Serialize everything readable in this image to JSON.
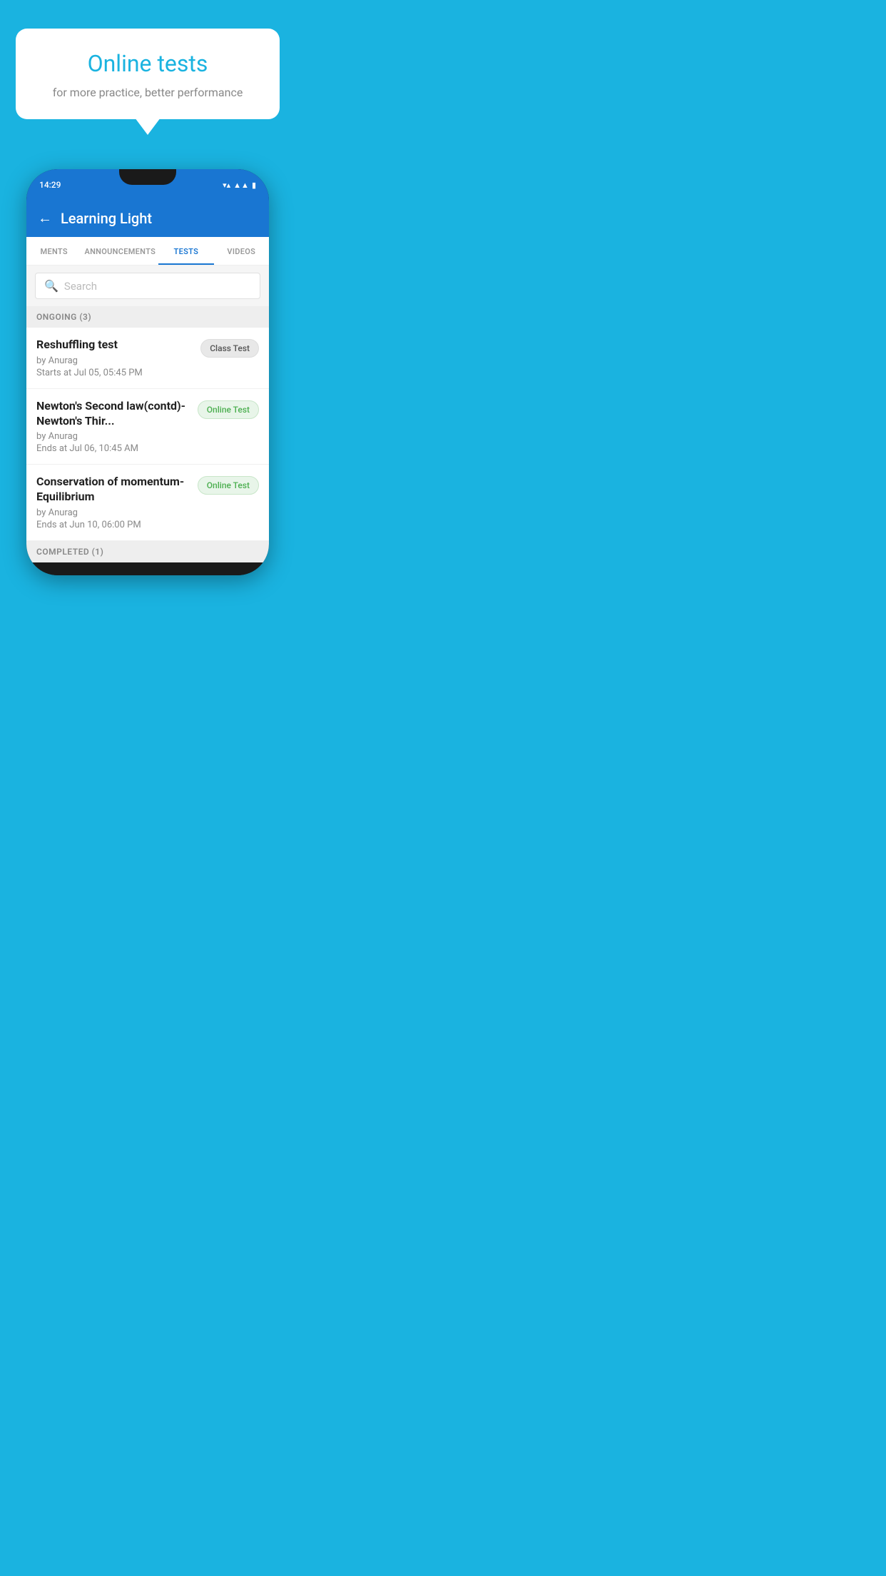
{
  "background_color": "#1ab3e0",
  "bubble": {
    "title": "Online tests",
    "subtitle": "for more practice, better performance"
  },
  "phone": {
    "status_bar": {
      "time": "14:29",
      "icons": [
        "wifi",
        "signal",
        "battery"
      ]
    },
    "app_bar": {
      "title": "Learning Light",
      "back_label": "←"
    },
    "tabs": [
      {
        "label": "MENTS",
        "active": false
      },
      {
        "label": "ANNOUNCEMENTS",
        "active": false
      },
      {
        "label": "TESTS",
        "active": true
      },
      {
        "label": "VIDEOS",
        "active": false
      }
    ],
    "search": {
      "placeholder": "Search"
    },
    "sections": [
      {
        "title": "ONGOING (3)",
        "items": [
          {
            "name": "Reshuffling test",
            "by": "by Anurag",
            "date": "Starts at  Jul 05, 05:45 PM",
            "badge": "Class Test",
            "badge_type": "class"
          },
          {
            "name": "Newton's Second law(contd)-Newton's Thir...",
            "by": "by Anurag",
            "date": "Ends at  Jul 06, 10:45 AM",
            "badge": "Online Test",
            "badge_type": "online"
          },
          {
            "name": "Conservation of momentum-Equilibrium",
            "by": "by Anurag",
            "date": "Ends at  Jun 10, 06:00 PM",
            "badge": "Online Test",
            "badge_type": "online"
          }
        ]
      }
    ],
    "completed_section": {
      "title": "COMPLETED (1)"
    }
  }
}
